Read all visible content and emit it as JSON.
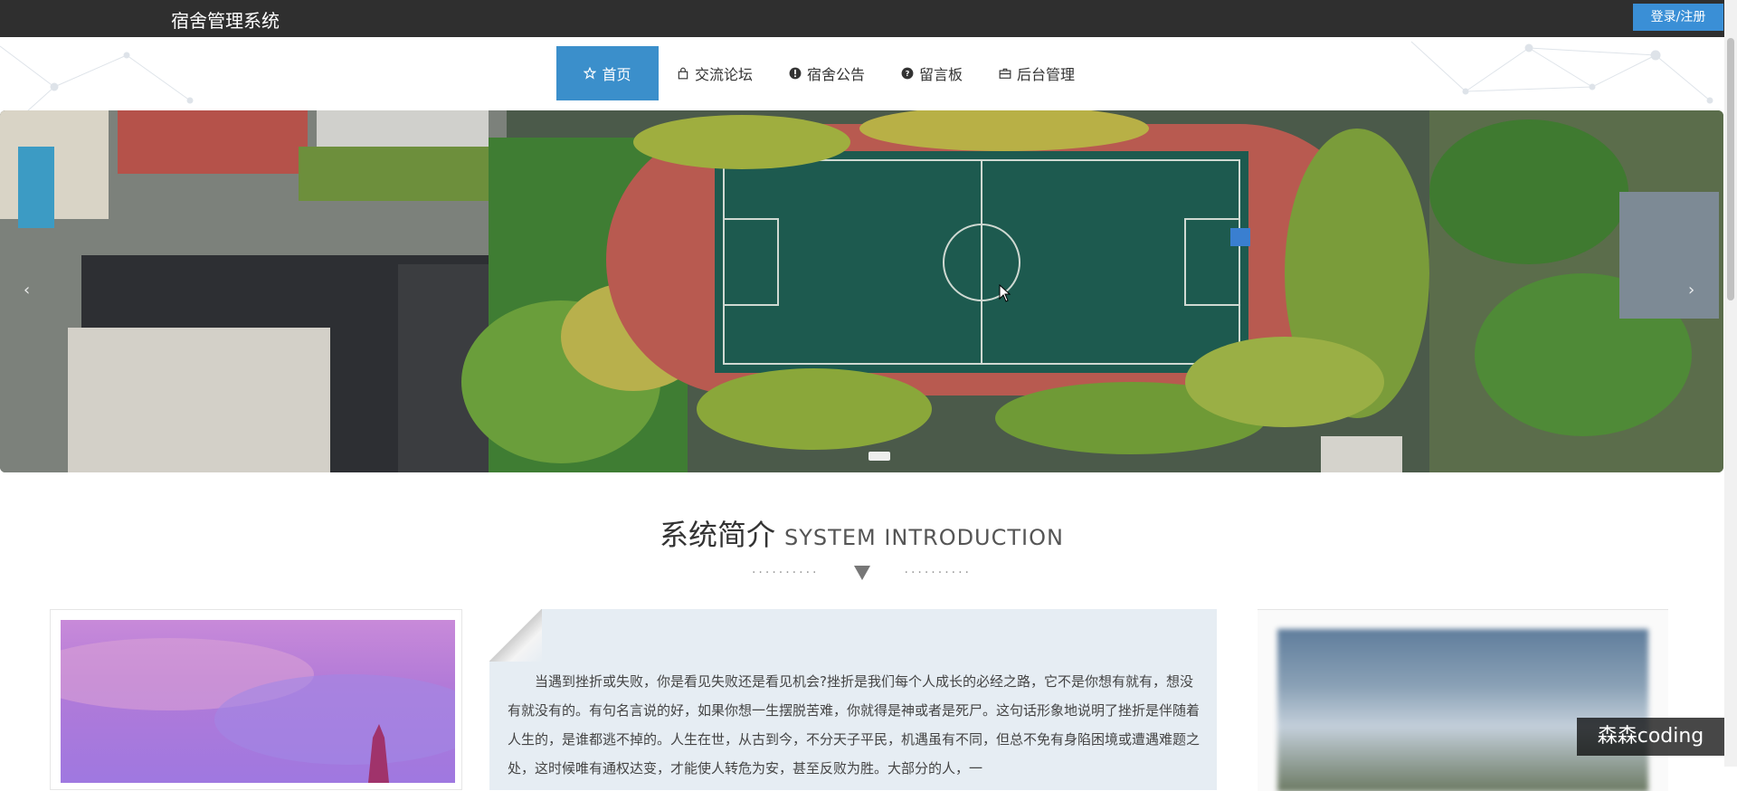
{
  "header": {
    "site_title": "宿舍管理系统",
    "login_label": "登录/注册"
  },
  "nav": {
    "items": [
      {
        "label": "首页",
        "icon": "star-icon",
        "active": true
      },
      {
        "label": "交流论坛",
        "icon": "bag-icon",
        "active": false
      },
      {
        "label": "宿舍公告",
        "icon": "info-icon",
        "active": false
      },
      {
        "label": "留言板",
        "icon": "question-icon",
        "active": false
      },
      {
        "label": "后台管理",
        "icon": "briefcase-icon",
        "active": false
      }
    ]
  },
  "banner": {
    "prev_arrow": "‹",
    "next_arrow": "›"
  },
  "intro": {
    "title_cn": "系统简介",
    "title_en": "SYSTEM INTRODUCTION",
    "divider_dots": "··········",
    "paragraph": "当遇到挫折或失败，你是看见失败还是看见机会?挫折是我们每个人成长的必经之路，它不是你想有就有，想没有就没有的。有句名言说的好，如果你想一生摆脱苦难，你就得是神或者是死尸。这句话形象地说明了挫折是伴随着人生的，是谁都逃不掉的。人生在世，从古到今，不分天子平民，机遇虽有不同，但总不免有身陷困境或遭遇难题之处，这时候唯有通权达变，才能使人转危为安，甚至反败为胜。大部分的人，一"
  },
  "watermark": "森森coding",
  "colors": {
    "topbar": "#2f2f2f",
    "accent": "#3b8fcb",
    "login_button": "#3a8fd6"
  }
}
